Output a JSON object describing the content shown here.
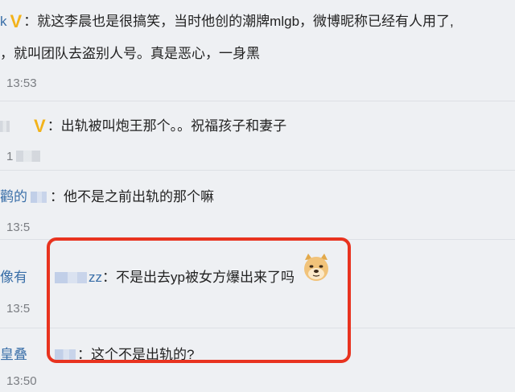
{
  "comments": [
    {
      "user_prefix": "k",
      "badge": "V",
      "line1": "：就这李晨也是很搞笑，当时他创的潮牌mlgb，微博昵称已经有人用了,",
      "line2": "，就叫团队去盗别人号。真是恶心，一身黑",
      "time": "13:53"
    },
    {
      "badge": "V",
      "text": "：出轨被叫炮王那个。。祝福孩子和妻子",
      "time": "1"
    },
    {
      "user_prefix": "鹳的",
      "text": "：他不是之前出轨的那个嘛",
      "time": "13:5"
    },
    {
      "user_prefix": "像有",
      "user_suffix": "zz",
      "text": "：不是出去yp被女方爆出来了吗",
      "time": "13:5"
    },
    {
      "user_prefix": "皇叠",
      "text": "：这个不是出轨的?",
      "time": "13:50"
    }
  ],
  "icons": {
    "verified": "verified-v-badge",
    "emoji": "doge-emoji"
  },
  "colors": {
    "highlight": "#e8331f",
    "username": "#3a6fa8",
    "badge": "#f2b21a"
  }
}
